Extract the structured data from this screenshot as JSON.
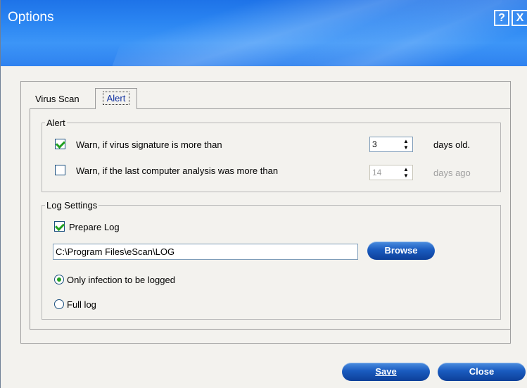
{
  "window": {
    "title": "Options",
    "help_label": "?",
    "close_label": "X"
  },
  "tabs": [
    {
      "label": "Virus Scan"
    },
    {
      "label": "Alert",
      "selected": true
    }
  ],
  "alert_group": {
    "legend": "Alert",
    "warn_signature": {
      "checked": true,
      "label": "Warn, if virus signature is more than",
      "value": "3",
      "suffix": "days old."
    },
    "warn_analysis": {
      "checked": false,
      "label": "Warn, if the last computer analysis was more than",
      "value": "14",
      "suffix": "days ago",
      "disabled": true
    }
  },
  "log_group": {
    "legend": "Log Settings",
    "prepare_log": {
      "checked": true,
      "label": "Prepare Log"
    },
    "path": "C:\\Program Files\\eScan\\LOG",
    "browse_label": "Browse",
    "options": [
      {
        "label": "Only infection to be logged",
        "selected": true
      },
      {
        "label": "Full log",
        "selected": false
      }
    ]
  },
  "footer": {
    "save_label": "Save",
    "close_label": "Close"
  },
  "colors": {
    "titlebar": "#2b86f2",
    "button": "#1a5bbf",
    "check": "#21a121"
  },
  "icons": {
    "help": "help-icon",
    "close": "close-icon",
    "spin": "spin-arrows-icon"
  }
}
